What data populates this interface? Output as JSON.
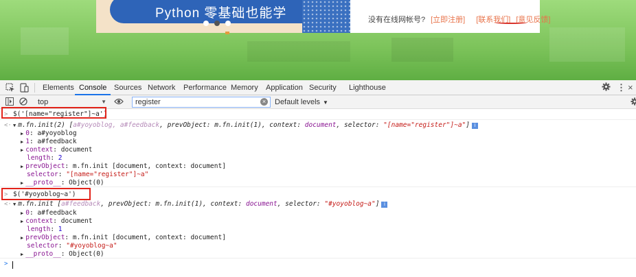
{
  "page": {
    "banner_title": "Python 零基础也能学",
    "nav": {
      "no_account": "没有在线网帐号?",
      "register": "[立即注册]",
      "contact": "[联系我们]",
      "feedback": "[意见反馈]"
    }
  },
  "devtools": {
    "tabs": [
      "Elements",
      "Console",
      "Sources",
      "Network",
      "Performance",
      "Memory",
      "Application",
      "Security",
      "Lighthouse"
    ],
    "active_tab": "Console",
    "more_tabs_icon": "»",
    "context": "top",
    "filter_value": "register",
    "levels": "Default levels",
    "accent_color": "#1a73e8",
    "highlight_color": "#e2231a"
  },
  "console": {
    "cmd1": "$('[name=\"register\"]~a')",
    "res1": {
      "summary_a": "m.fn.init(2) [",
      "summary_b": "a#yoyoblog, a#feedback",
      "summary_c": ", prevObject: m.fn.init(1), context: ",
      "summary_d": "document",
      "summary_e": ", selector: ",
      "summary_f": "\"[name=\"register\"]~a\"",
      "summary_g": "]",
      "lines": [
        {
          "key": "0",
          "val": "a#yoyoblog",
          "tri": true
        },
        {
          "key": "1",
          "val": "a#feedback",
          "tri": true
        },
        {
          "key": "context",
          "val": "document",
          "tri": true
        },
        {
          "key": "length",
          "val": "2",
          "tri": false
        },
        {
          "key": "prevObject",
          "val": "m.fn.init [document, context: document]",
          "tri": true
        },
        {
          "key": "selector",
          "val": "\"[name=\"register\"]~a\"",
          "tri": false
        },
        {
          "key": "__proto__",
          "val": "Object(0)",
          "tri": true
        }
      ]
    },
    "cmd2": "$('#yoyoblog~a')",
    "res2": {
      "summary_a": "m.fn.init [",
      "summary_b": "a#feedback",
      "summary_c": ", prevObject: m.fn.init(1), context: ",
      "summary_d": "document",
      "summary_e": ", selector: ",
      "summary_f": "\"#yoyoblog~a\"",
      "summary_g": "]",
      "lines": [
        {
          "key": "0",
          "val": "a#feedback",
          "tri": true
        },
        {
          "key": "context",
          "val": "document",
          "tri": true
        },
        {
          "key": "length",
          "val": "1",
          "tri": false
        },
        {
          "key": "prevObject",
          "val": "m.fn.init [document, context: document]",
          "tri": true
        },
        {
          "key": "selector",
          "val": "\"#yoyoblog~a\"",
          "tri": false
        },
        {
          "key": "__proto__",
          "val": "Object(0)",
          "tri": true
        }
      ]
    }
  }
}
